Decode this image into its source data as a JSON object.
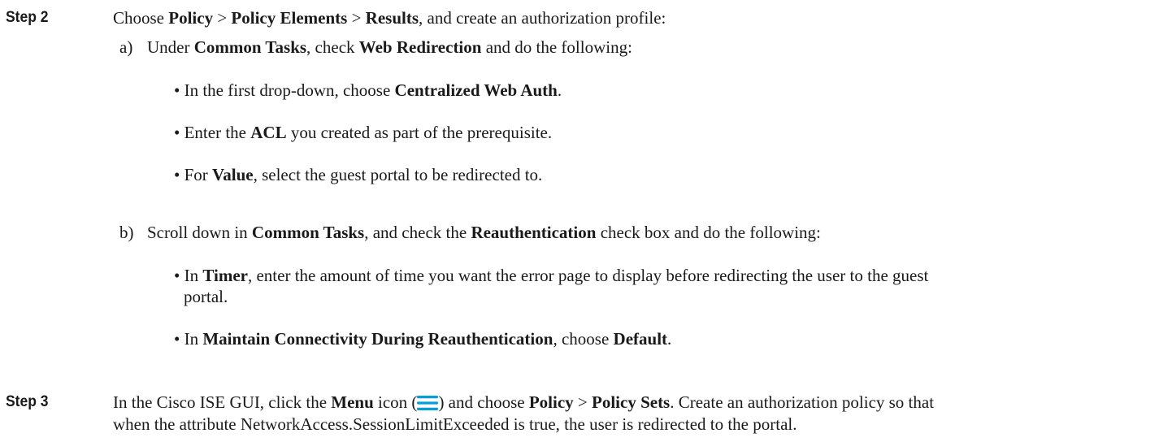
{
  "step2": {
    "label": "Step 2",
    "intro": {
      "t1": "Choose ",
      "b1": "Policy",
      "t2": " > ",
      "b2": "Policy Elements",
      "t3": " > ",
      "b3": "Results",
      "t4": ", and create an authorization profile:"
    },
    "sub_a": {
      "marker": "a)",
      "t1": "Under ",
      "b1": "Common Tasks",
      "t2": ", check ",
      "b2": "Web Redirection",
      "t3": " and do the following:",
      "bullets": [
        {
          "t1": "• In the first drop-down, choose ",
          "b1": "Centralized Web Auth",
          "t2": "."
        },
        {
          "t1": "• Enter the ",
          "b1": "ACL",
          "t2": " you created as part of the prerequisite."
        },
        {
          "t1": "• For ",
          "b1": "Value",
          "t2": ", select the guest portal to be redirected to."
        }
      ]
    },
    "sub_b": {
      "marker": "b)",
      "t1": "Scroll down in ",
      "b1": "Common Tasks",
      "t2": ", and check the ",
      "b2": "Reauthentication",
      "t3": " check box and do the following:",
      "bullets": [
        {
          "t1": "• In ",
          "b1": "Timer",
          "t2": ", enter the amount of time you want the error page to display before redirecting the user to the guest",
          "t3": "portal."
        },
        {
          "t1": "• In ",
          "b1": "Maintain Connectivity During Reauthentication",
          "t2": ", choose ",
          "b2": "Default",
          "t3": "."
        }
      ]
    }
  },
  "step3": {
    "label": "Step 3",
    "t1": "In the Cisco ISE GUI, click the ",
    "b1": "Menu",
    "t2": " icon (",
    "icon": "menu-icon",
    "t3": ") and choose ",
    "b2": "Policy",
    "t4": " > ",
    "b3": "Policy Sets",
    "t5": ". Create an authorization policy so that",
    "line2": "when the attribute NetworkAccess.SessionLimitExceeded is true, the user is redirected to the portal."
  },
  "colors": {
    "text": "#1a1a1a",
    "icon": "#049fd9"
  }
}
